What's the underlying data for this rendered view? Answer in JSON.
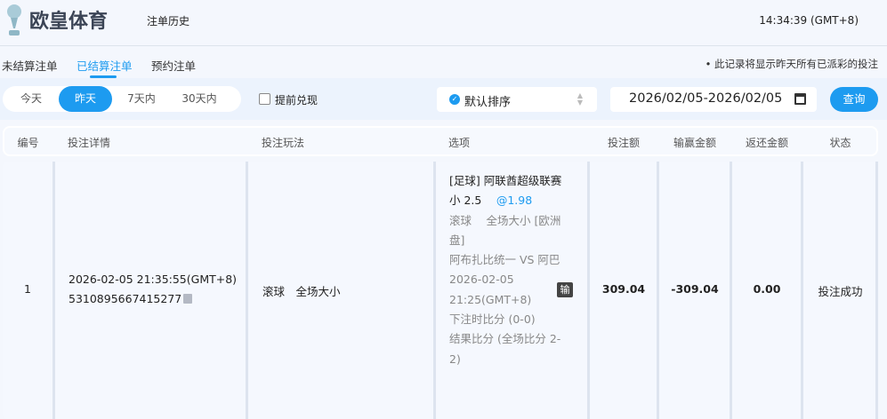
{
  "header": {
    "brand": "欧皇体育",
    "page_title": "注单历史",
    "clock": "14:34:39 (GMT+8)"
  },
  "tabs": [
    {
      "label": "未结算注单"
    },
    {
      "label": "已结算注单",
      "active": true
    },
    {
      "label": "预约注单"
    }
  ],
  "note": "• 此记录将显示昨天所有已派彩的投注",
  "filters": {
    "ranges": [
      {
        "label": "今天"
      },
      {
        "label": "昨天",
        "active": true
      },
      {
        "label": "7天内"
      },
      {
        "label": "30天内"
      }
    ],
    "early_cashout_label": "提前兑现",
    "early_cashout_checked": false,
    "sort_value": "默认排序",
    "date_range": "2026/02/05-2026/02/05",
    "query_label": "查询"
  },
  "columns": [
    "编号",
    "投注详情",
    "投注玩法",
    "选项",
    "投注额",
    "输赢金额",
    "返还金额",
    "状态"
  ],
  "rows": [
    {
      "no": "1",
      "time": "2026-02-05 21:35:55(GMT+8)",
      "bet_id": "5310895667415277",
      "play": "滚球　全场大小",
      "option": {
        "league": "[足球] 阿联酋超级联赛",
        "pick": "小 2.5",
        "odds": "@1.98",
        "market": "滚球　 全场大小 [欧洲盘]",
        "match": "阿布扎比统一 VS 阿巴",
        "match_time": "2026-02-05 21:25(GMT+8)",
        "score_at_bet": "下注时比分 (0-0)",
        "result": "结果比分 (全场比分 2-2)",
        "badge": "输"
      },
      "stake": "309.04",
      "win_loss": "-309.04",
      "returned": "0.00",
      "status": "投注成功"
    }
  ],
  "colors": {
    "accent": "#1d9bf0",
    "badge": "#444444"
  }
}
